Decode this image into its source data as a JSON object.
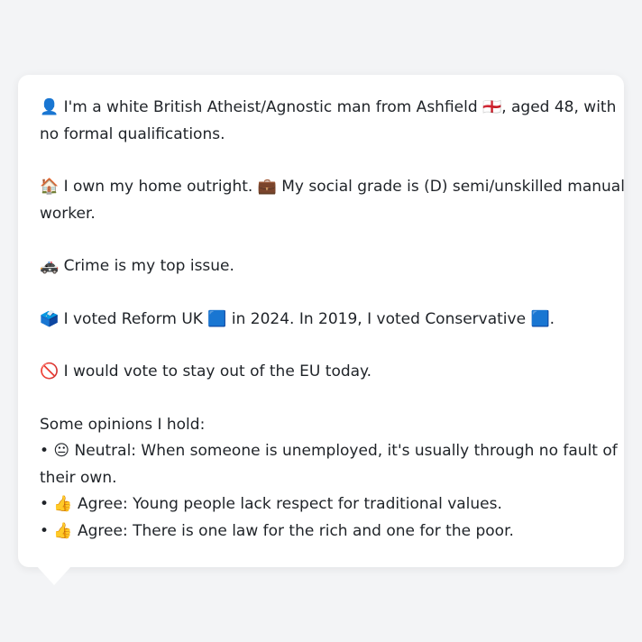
{
  "profile": {
    "identity_line1": "👤 I'm a white British Atheist/Agnostic man from Ashfield 🏴󠁧󠁢󠁥󠁮󠁧󠁿, aged 48, with",
    "identity_line2": "no formal qualifications.",
    "home_line1": "🏠 I own my home outright. 💼 My social grade is (D) semi/unskilled manual",
    "home_line2": "worker.",
    "issue_line": "🚓 Crime is my top issue.",
    "vote_line": "🗳️ I voted Reform UK 🟦 in 2024. In 2019, I voted Conservative 🟦.",
    "eu_line": "🚫 I would vote to stay out of the EU today.",
    "opinions_heading": "Some opinions I hold:",
    "opinion1_line1": "• 😐 Neutral: When someone is unemployed, it's usually through no fault of",
    "opinion1_line2": "their own.",
    "opinion2": "• 👍 Agree: Young people lack respect for traditional values.",
    "opinion3": "• 👍 Agree: There is one law for the rich and one for the poor."
  }
}
